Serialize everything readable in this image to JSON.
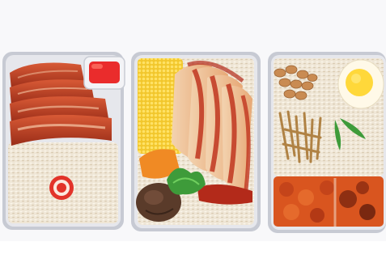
{
  "image": {
    "subject": "three-meal-trays",
    "colors": {
      "background": "#f7f7f9",
      "tray": "#d9dbe2",
      "tray_edge": "#b9bcc6",
      "rice": "#efe6d6",
      "rice_shadow": "#d7c9b0",
      "char_siu": "#c2452b",
      "char_siu_dark": "#8e2a18",
      "chicken": "#f0c7a0",
      "sauce": "#b32a1a",
      "egg_yolk": "#ffd83a",
      "egg_white": "#fff9e8",
      "corn": "#f6d33c",
      "carrot": "#f08a24",
      "mushroom": "#5a3b2a",
      "herb": "#3e9b3a",
      "chili_sauce": "#ea2c2c",
      "peanut": "#c98b52",
      "anchovy": "#c9a366",
      "sambal": "#d9551f"
    },
    "trays": [
      {
        "name": "char-siu-rice-tray"
      },
      {
        "name": "chicken-rice-tray"
      },
      {
        "name": "nasi-lemak-tray"
      }
    ]
  }
}
